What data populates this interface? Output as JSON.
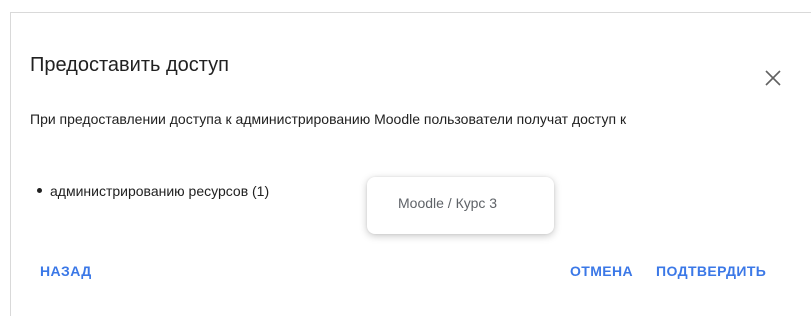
{
  "dialog": {
    "title": "Предоставить доступ",
    "close_icon": "close-icon",
    "description": "При предоставлении доступа к администрированию Moodle пользователи получат доступ к",
    "bullets": [
      {
        "text": "администрированию ресурсов (1)"
      }
    ],
    "tooltip": "Moodle / Курс 3",
    "buttons": {
      "back": "НАЗАД",
      "cancel": "ОТМЕНА",
      "confirm": "ПОДТВЕРДИТЬ"
    }
  },
  "colors": {
    "accent": "#3b78e7",
    "text": "#212121",
    "tooltip_text": "#5f6368"
  }
}
